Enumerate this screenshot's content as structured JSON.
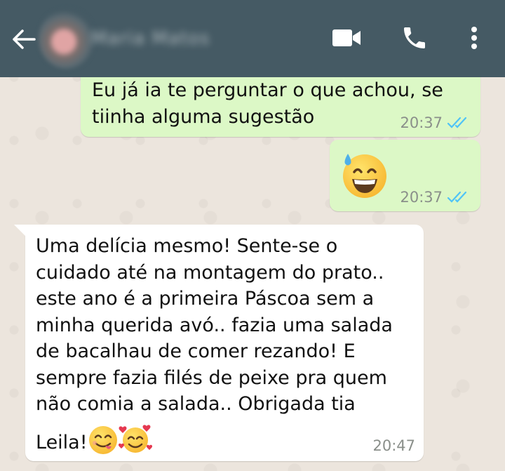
{
  "header": {
    "contact_name": "Maria Matos",
    "icons": [
      "back-arrow-icon",
      "video-camera-icon",
      "phone-icon",
      "more-vert-icon"
    ]
  },
  "messages": [
    {
      "direction": "outgoing",
      "text_lines": [
        "Eu já ia te perguntar o que achou, se",
        "tiinha alguma sugestão"
      ],
      "time": "20:37",
      "status": "read"
    },
    {
      "direction": "outgoing",
      "emoji": "grinning-face-with-sweat",
      "time": "20:37",
      "status": "read"
    },
    {
      "direction": "incoming",
      "text_lines": [
        "Uma delícia mesmo! Sente-se o",
        "cuidado até na montagem do prato..",
        "este ano é a primeira Páscoa sem a",
        "minha querida avó.. fazia uma salada",
        "de bacalhau de comer rezando! E",
        "sempre fazia filés de peixe pra quem",
        "não comia a salada..  Obrigada tia",
        "Leila!"
      ],
      "trailing_emojis": [
        "face-savoring-food",
        "smiling-face-with-hearts"
      ],
      "time": "20:47"
    }
  ],
  "colors": {
    "header": "#455a64",
    "outgoing_bubble": "#dcf8c6",
    "incoming_bubble": "#ffffff",
    "read_ticks": "#4fc3f7",
    "wallpaper": "#ece5dd"
  }
}
